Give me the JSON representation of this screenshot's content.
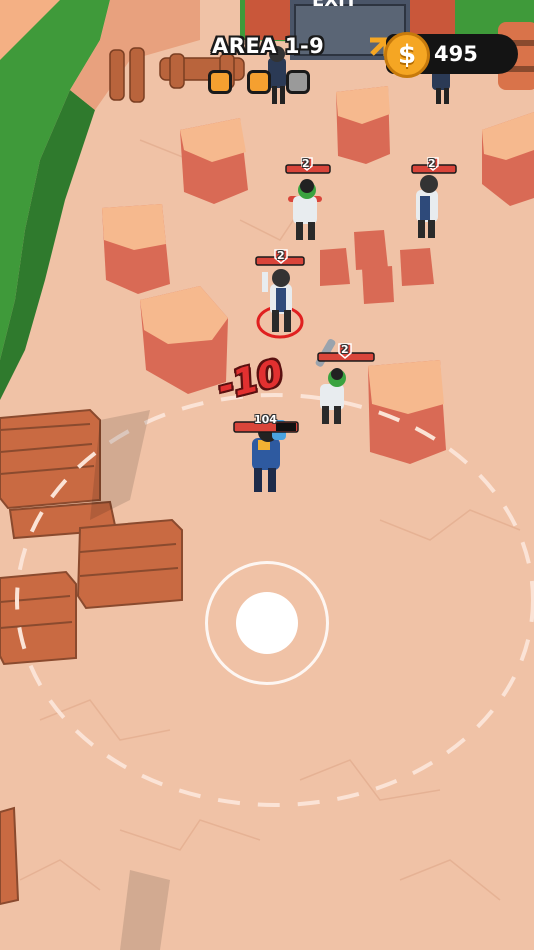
{
  "hud": {
    "area_label": "AREA 1-9",
    "coins": "495",
    "coin_symbol": "$",
    "stage_progress": [
      {
        "state": "done",
        "color": "#f5a030"
      },
      {
        "state": "done",
        "color": "#f5a030"
      },
      {
        "state": "pending",
        "color": "#9a9a9a"
      }
    ]
  },
  "exit_gate_label": "EXIT",
  "floating_damage": "-10",
  "player": {
    "hp": "104"
  },
  "enemies": [
    {
      "level": "2"
    },
    {
      "level": "2"
    },
    {
      "level": "2"
    },
    {
      "level": "2"
    }
  ],
  "colors": {
    "ground": "#f0c2a6",
    "grass": "#3f9a3a",
    "rock": "#e07a5f",
    "rock_top": "#f6b98e",
    "crate": "#c96a42",
    "enemy_hp": "#d9453a",
    "coin": "#f5a623"
  }
}
